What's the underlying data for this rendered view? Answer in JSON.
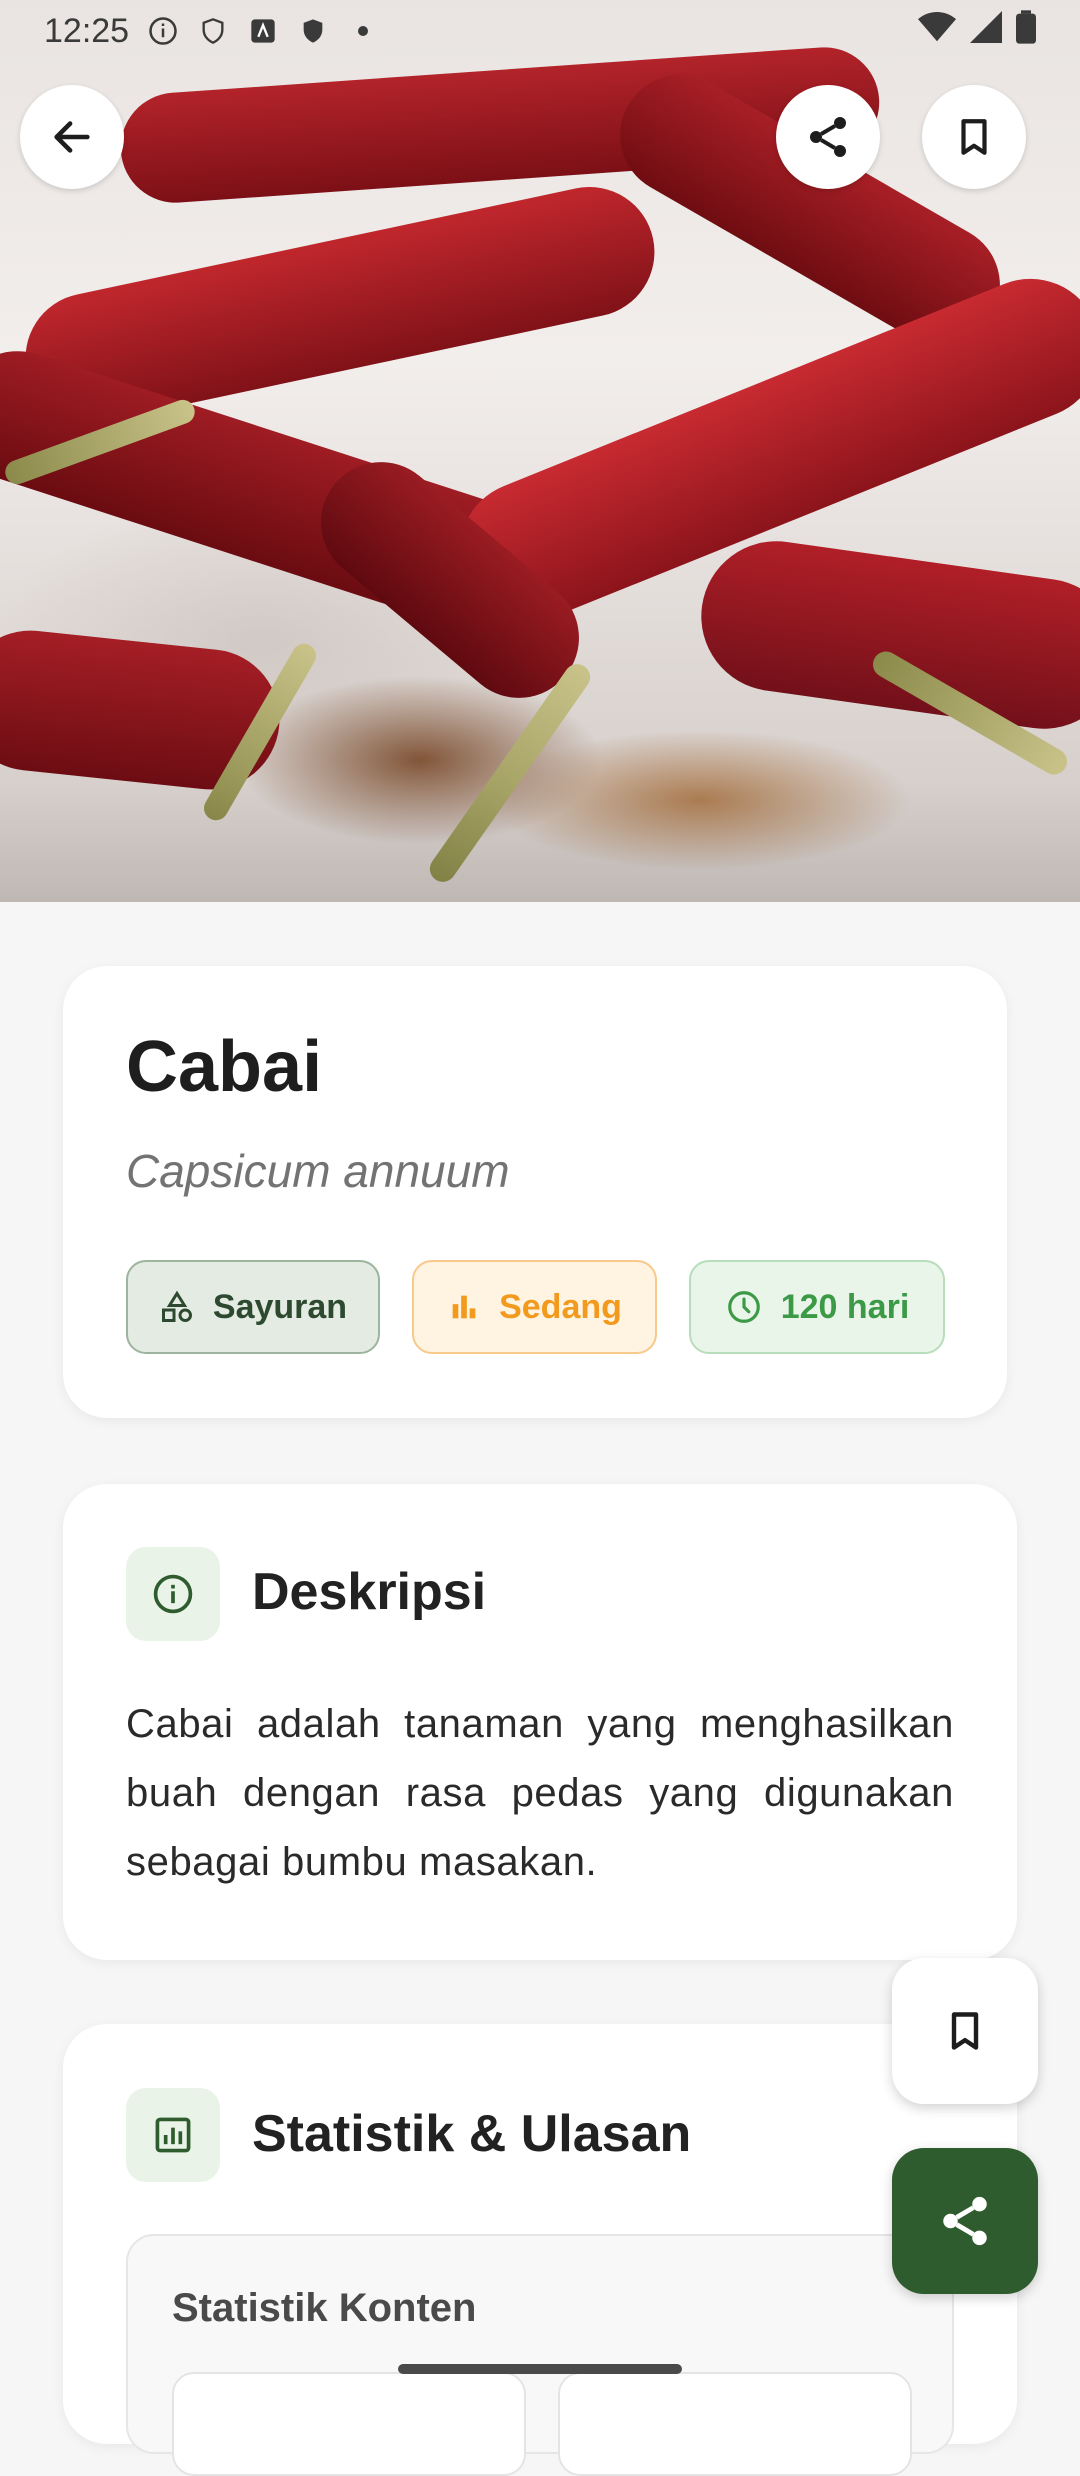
{
  "status_bar": {
    "time": "12:25"
  },
  "plant": {
    "name": "Cabai",
    "scientific_name": "Capsicum annuum",
    "chips": {
      "category": "Sayuran",
      "difficulty": "Sedang",
      "duration": "120 hari"
    }
  },
  "description": {
    "title": "Deskripsi",
    "text": "Cabai adalah tanaman yang menghasilkan buah dengan rasa pedas yang digunakan sebagai bumbu masakan."
  },
  "stats": {
    "title": "Statistik & Ulasan",
    "content_title": "Statistik Konten"
  },
  "colors": {
    "primary_green": "#2e5c2e",
    "chip_orange": "#f29a1e",
    "chip_green": "#3c9a47"
  },
  "icons": {
    "back": "arrow-left-icon",
    "share": "share-icon",
    "bookmark": "bookmark-icon",
    "category": "shapes-icon",
    "difficulty": "bar-chart-icon",
    "duration": "clock-icon",
    "info": "info-icon",
    "stats": "analytics-icon"
  }
}
